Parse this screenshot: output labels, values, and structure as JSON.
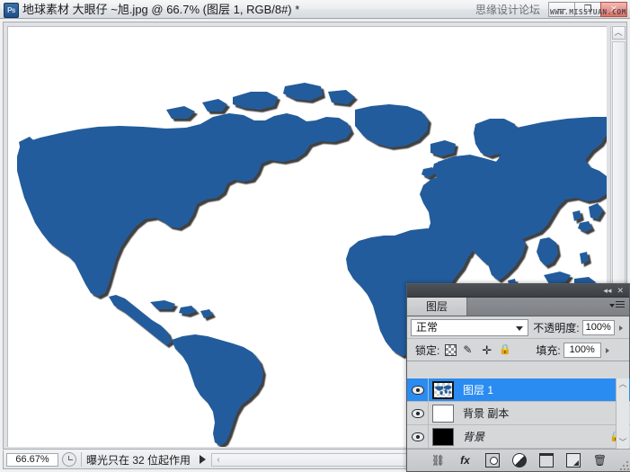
{
  "titlebar": {
    "app_icon_label": "Ps",
    "document_title": "地球素材 大眼仔 ~旭.jpg @ 66.7% (图层 1, RGB/8#) *",
    "brand": "思缘设计论坛",
    "watermark": "WWW.MISSYUAN.COM",
    "minimize_glyph": "—",
    "maximize_glyph": "❐",
    "close_glyph": "✕"
  },
  "canvas": {
    "background_color": "#ffffff",
    "land_color": "#215c9c",
    "shadow_color": "#1a1a1a",
    "scroll_up_glyph": "︿"
  },
  "statusbar": {
    "zoom_level": "66.67%",
    "clock_icon": "clock-icon",
    "message": "曝光只在 32 位起作用",
    "play_glyph": "▶",
    "hscroll_arrow_glyph": "‹"
  },
  "panel": {
    "collapse_glyph": "◂◂",
    "close_glyph": "✕",
    "tab_label": "图层",
    "menu_icon": "panel-menu-icon",
    "blend_mode": "正常",
    "opacity_label": "不透明度:",
    "opacity_value": "100%",
    "lock_label": "锁定:",
    "lock_icons": [
      "lock-transparency-icon",
      "lock-image-icon",
      "lock-position-icon",
      "lock-all-icon"
    ],
    "lock_brush_glyph": "✎",
    "lock_move_glyph": "✛",
    "lock_all_glyph": "🔒",
    "fill_label": "填充:",
    "fill_value": "100%",
    "selection_color": "#2a8cf0",
    "layers": [
      {
        "name": "图层 1",
        "visible": true,
        "selected": true,
        "thumb": "map",
        "locked": false,
        "italic": false
      },
      {
        "name": "背景 副本",
        "visible": true,
        "selected": false,
        "thumb": "white",
        "locked": false,
        "italic": false
      },
      {
        "name": "背景",
        "visible": true,
        "selected": false,
        "thumb": "black",
        "locked": true,
        "italic": true,
        "lock_glyph": "🔒"
      }
    ],
    "list_scroll_up_glyph": "︿",
    "list_scroll_down_glyph": "﹀",
    "footer_icons": [
      {
        "name": "link-layers-icon",
        "glyph": "⛓"
      },
      {
        "name": "layer-style-fx-icon",
        "glyph": "fx"
      },
      {
        "name": "add-layer-mask-icon",
        "glyph": ""
      },
      {
        "name": "adjustment-layer-icon",
        "glyph": ""
      },
      {
        "name": "new-group-icon",
        "glyph": ""
      },
      {
        "name": "new-layer-icon",
        "glyph": ""
      },
      {
        "name": "delete-layer-icon",
        "glyph": "🗑"
      }
    ]
  }
}
